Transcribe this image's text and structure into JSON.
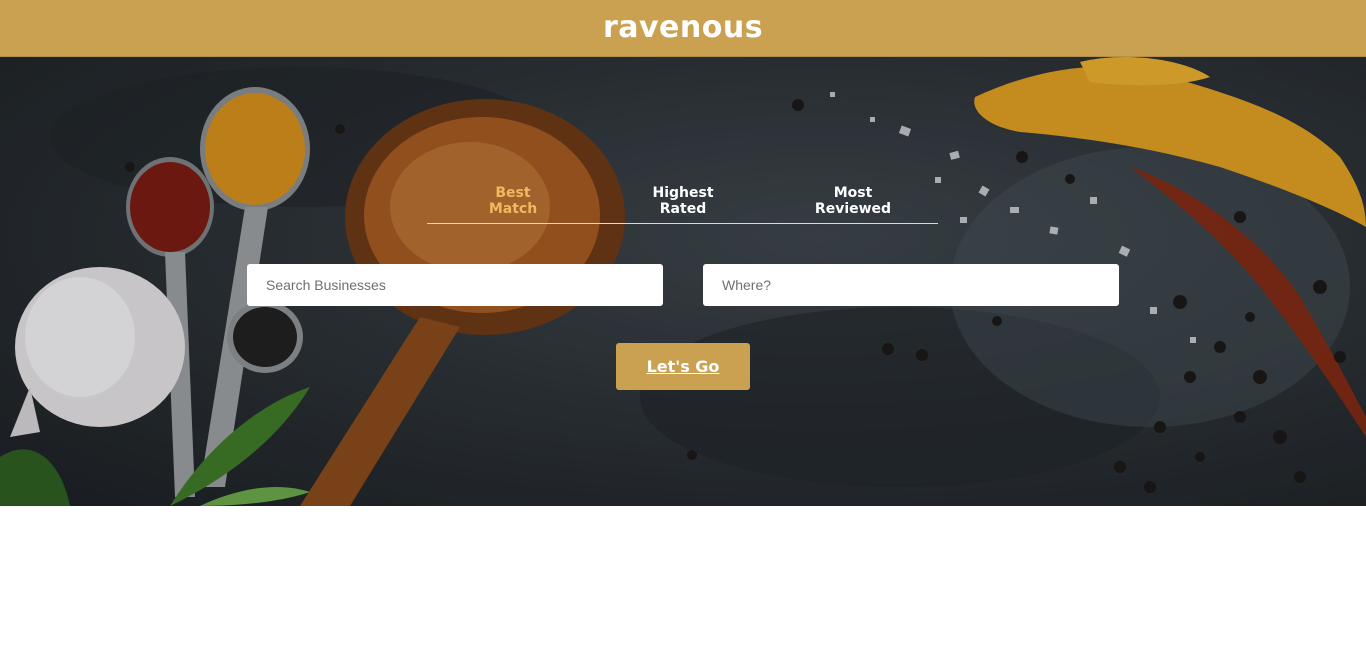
{
  "header": {
    "logo": "ravenous"
  },
  "sort_options": [
    {
      "line1": "Best",
      "line2": "Match",
      "active": true
    },
    {
      "line1": "Highest",
      "line2": "Rated",
      "active": false
    },
    {
      "line1": "Most",
      "line2": "Reviewed",
      "active": false
    }
  ],
  "search": {
    "term_placeholder": "Search Businesses",
    "location_placeholder": "Where?",
    "button_label": "Let's Go"
  },
  "colors": {
    "brand": "#caa150",
    "active_tab": "#f2b75f"
  }
}
